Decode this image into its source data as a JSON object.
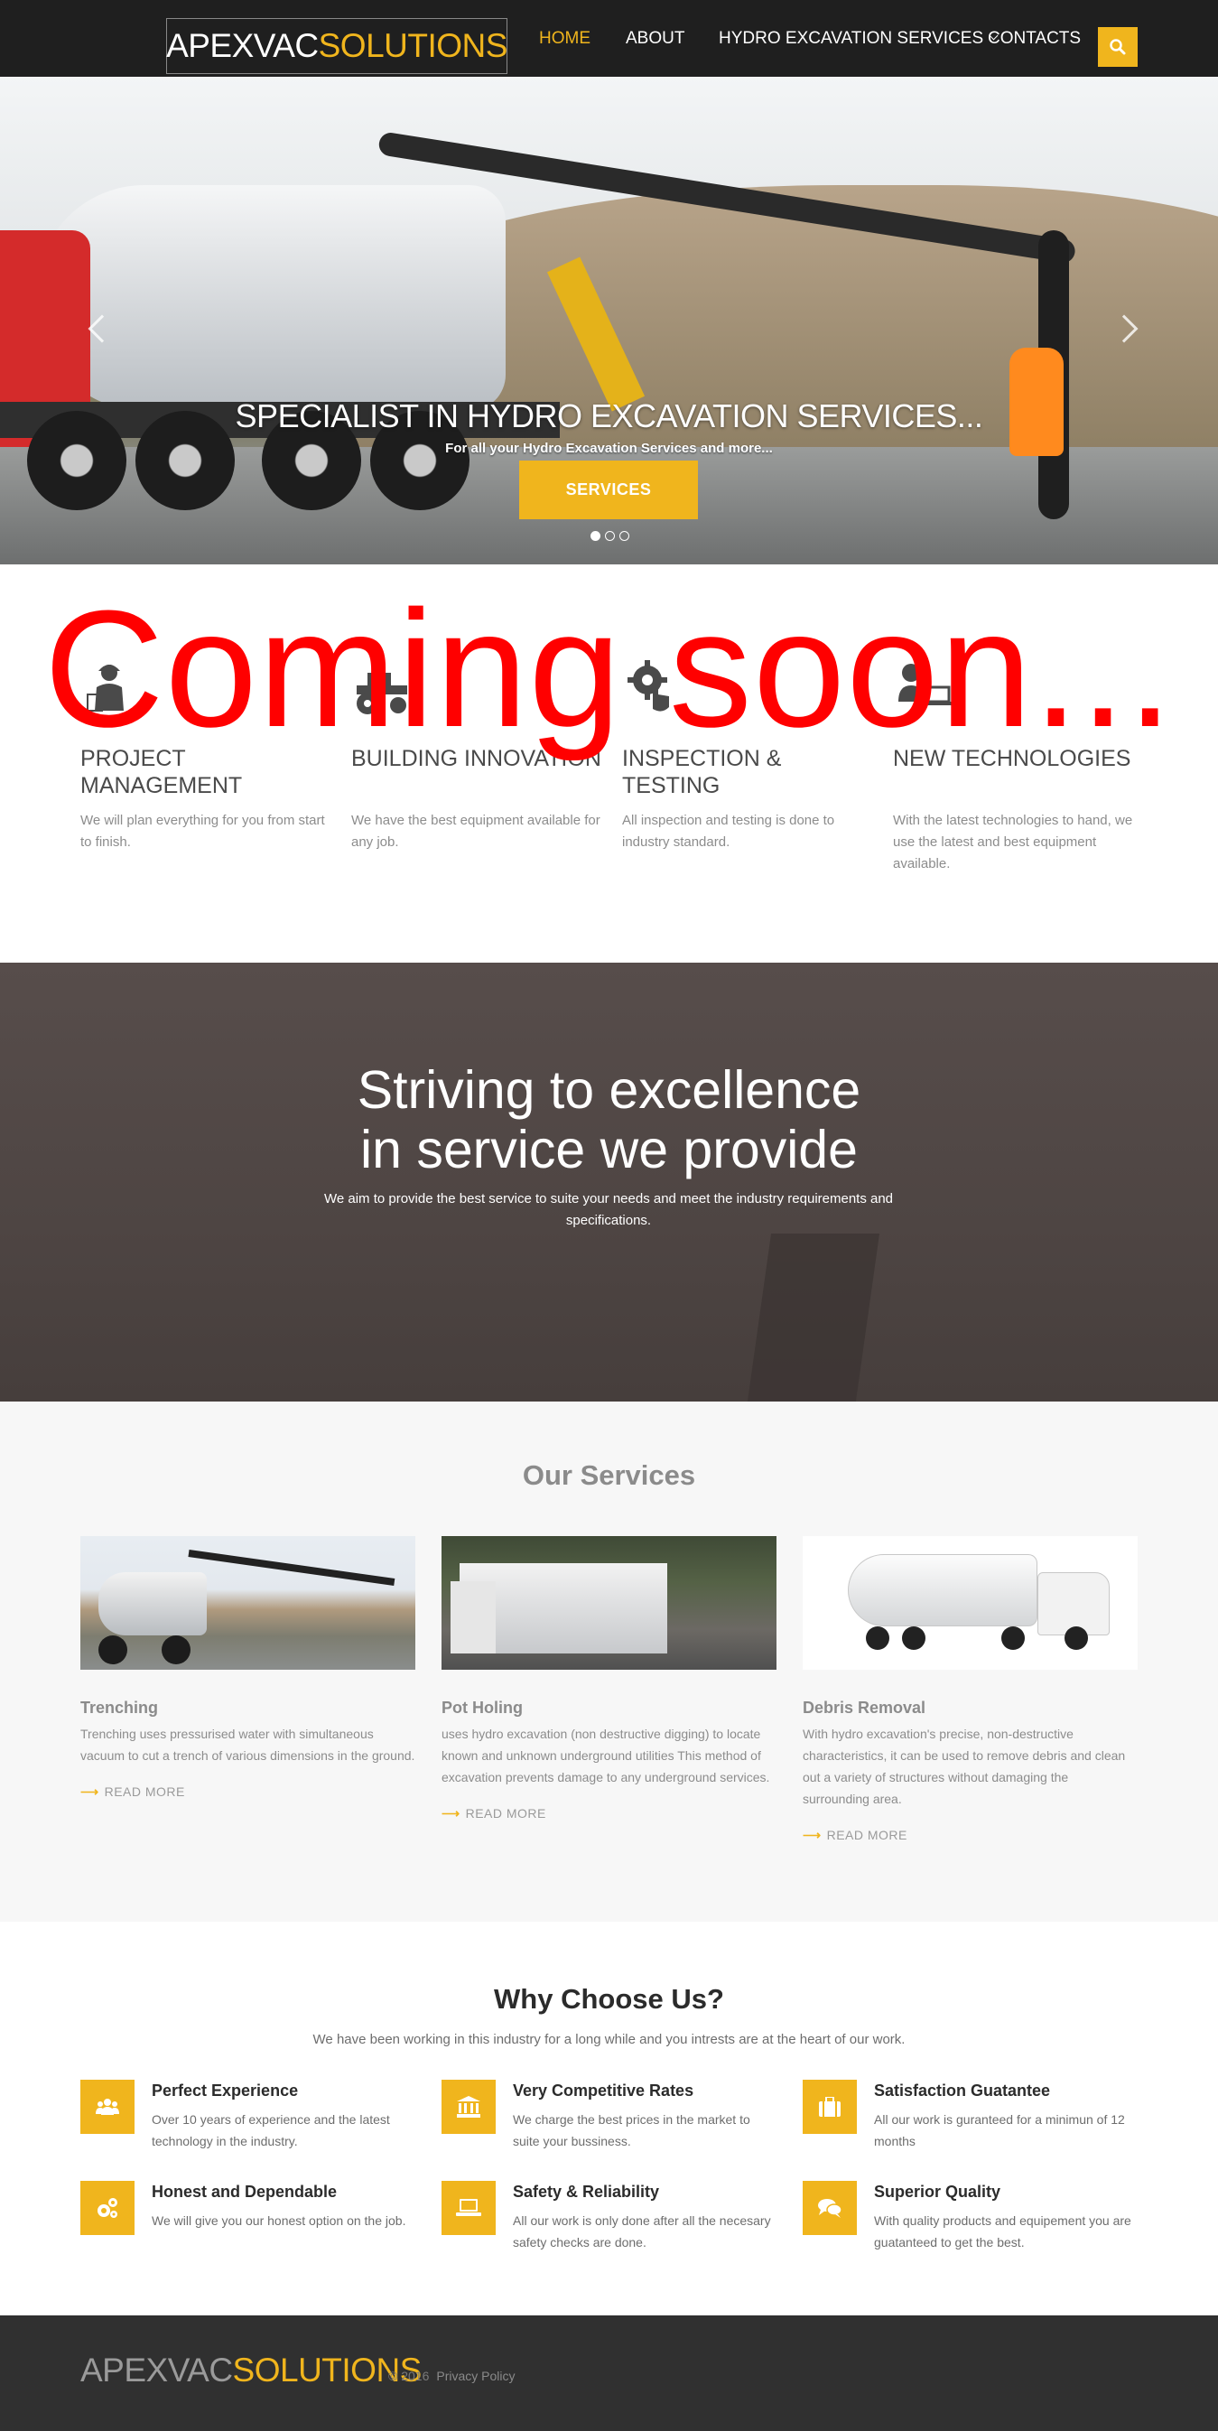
{
  "header": {
    "logo_part1": "APEXVAC",
    "logo_part2": "SOLUTIONS",
    "nav": {
      "home": "HOME",
      "about": "ABOUT",
      "hydro": "HYDRO EXCAVATION SERVICES",
      "contacts": "CONTACTS"
    },
    "search_icon": "search-icon"
  },
  "hero": {
    "title": "SPECIALIST IN HYDRO EXCAVATION SERVICES...",
    "subtitle": "For all your Hydro Excavation Services and more...",
    "button": "SERVICES",
    "slide_count": 3,
    "active_slide": 1
  },
  "overlay": {
    "coming_soon": "Coming soon..."
  },
  "features": [
    {
      "title": "PROJECT MANAGEMENT",
      "text": "We will plan everything for you from start to finish.",
      "icon": "worker-icon"
    },
    {
      "title": "BUILDING INNOVATION",
      "text": "We have the best equipment available for any job.",
      "icon": "tractor-icon"
    },
    {
      "title": "INSPECTION & TESTING",
      "text": "All inspection and testing is done to industry standard.",
      "icon": "gear-hand-icon"
    },
    {
      "title": "NEW TECHNOLOGIES",
      "text": "With the latest technologies to hand, we use the latest and best equipment available.",
      "icon": "person-laptop-icon"
    }
  ],
  "excellence": {
    "title_line1": "Striving to excellence",
    "title_line2": "in service we provide",
    "text": "We aim to provide the best service to suite your needs and meet the industry requirements and specifications."
  },
  "services": {
    "heading": "Our Services",
    "items": [
      {
        "title": "Trenching",
        "text": "Trenching uses pressurised water with simultaneous vacuum to cut a trench of various dimensions in the ground.",
        "more": "READ MORE"
      },
      {
        "title": "Pot Holing",
        "text": "uses hydro excavation (non destructive digging) to locate known and unknown underground utilities This method of excavation prevents damage to any underground services.",
        "more": "READ MORE"
      },
      {
        "title": "Debris Removal",
        "text": "With hydro excavation's precise, non-destructive characteristics, it can be used to remove debris and clean out a variety of structures without damaging the surrounding area.",
        "more": "READ MORE"
      }
    ]
  },
  "why": {
    "heading": "Why Choose Us?",
    "subtitle": "We have been working in this industry for a long while and you intrests are at the heart of our work.",
    "items": [
      {
        "title": "Perfect Experience",
        "text": "Over 10 years of experience and the latest technology in the industry.",
        "icon": "users-icon"
      },
      {
        "title": "Very Competitive Rates",
        "text": "We charge the best prices in the market to suite your bussiness.",
        "icon": "bank-icon"
      },
      {
        "title": "Satisfaction Guatantee",
        "text": "All our work is guranteed for a minimun of 12 months",
        "icon": "briefcase-icon"
      },
      {
        "title": "Honest and Dependable",
        "text": "We will give you our honest option on the job.",
        "icon": "gears-icon"
      },
      {
        "title": "Safety & Reliability",
        "text": "All our work is only done after all the necesary safety checks are done.",
        "icon": "laptop-icon"
      },
      {
        "title": "Superior Quality",
        "text": "With quality products and equipement you are guatanteed to get the best.",
        "icon": "comments-icon"
      }
    ]
  },
  "footer": {
    "logo_part1": "APEXVAC",
    "logo_part2": "SOLUTIONS",
    "copyright": "© 2016",
    "privacy": "Privacy Policy"
  },
  "colors": {
    "accent": "#f0b51d",
    "header_bg": "#1f1f1f",
    "overlay_red": "#ff0000",
    "footer_bg": "#303030"
  }
}
